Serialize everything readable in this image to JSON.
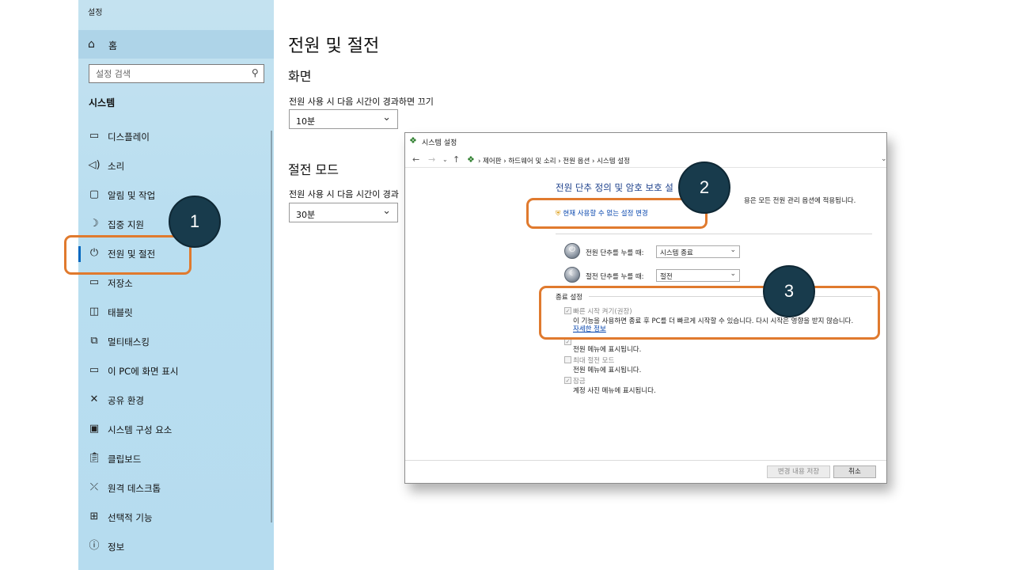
{
  "settings": {
    "window_title": "설정",
    "home": "홈",
    "search_placeholder": "설정 검색",
    "section": "시스템",
    "nav": [
      {
        "label": "디스플레이",
        "icon": "display-icon"
      },
      {
        "label": "소리",
        "icon": "sound-icon"
      },
      {
        "label": "알림 및 작업",
        "icon": "notifications-icon"
      },
      {
        "label": "집중 지원",
        "icon": "focus-assist-icon"
      },
      {
        "label": "전원 및 절전",
        "icon": "power-icon"
      },
      {
        "label": "저장소",
        "icon": "storage-icon"
      },
      {
        "label": "태블릿",
        "icon": "tablet-icon"
      },
      {
        "label": "멀티태스킹",
        "icon": "multitasking-icon"
      },
      {
        "label": "이 PC에 화면 표시",
        "icon": "projecting-icon"
      },
      {
        "label": "공유 환경",
        "icon": "shared-experiences-icon"
      },
      {
        "label": "시스템 구성 요소",
        "icon": "system-components-icon"
      },
      {
        "label": "클립보드",
        "icon": "clipboard-icon"
      },
      {
        "label": "원격 데스크톱",
        "icon": "remote-desktop-icon"
      },
      {
        "label": "선택적 기능",
        "icon": "optional-features-icon"
      },
      {
        "label": "정보",
        "icon": "info-icon"
      }
    ],
    "content": {
      "title": "전원 및 절전",
      "screen_section": "화면",
      "screen_label": "전원 사용 시 다음 시간이 경과하면 끄기",
      "screen_value": "10분",
      "sleep_section": "절전 모드",
      "sleep_label": "전원 사용 시 다음 시간이 경과",
      "sleep_value": "30분"
    }
  },
  "control_panel": {
    "title": "시스템 설정",
    "breadcrumbs": "›  제어판  ›  하드웨어 및 소리  ›  전원 옵션  ›  시스템 설정",
    "heading": "전원 단추 정의 및 암호 보호 설",
    "description": "용은 모든 전원 관리 옵션에 적용됩니다.",
    "change_link": "현재 사용할 수 없는 설정 변경",
    "power_button_label": "전원 단추를 누를 때:",
    "power_button_value": "시스템 종료",
    "sleep_button_label": "절전 단추를 누를 때:",
    "sleep_button_value": "절전",
    "shutdown_title": "종료 설정",
    "fast_startup_label": "빠른 시작 켜기(권장)",
    "fast_startup_desc": "이 기능을 사용하면 종료 후 PC를 더 빠르게 시작할 수 있습니다. 다시 시작은 영향을 받지 않습니다.",
    "more_info": "자세한 정보",
    "sleep_desc": "전원 메뉴에 표시됩니다.",
    "hibernate_label": "최대 절전 모드",
    "hibernate_desc": "전원 메뉴에 표시됩니다.",
    "lock_label": "잠금",
    "lock_desc": "계정 사진 메뉴에 표시됩니다.",
    "save_button": "변경 내용 저장",
    "cancel_button": "취소"
  },
  "annotations": {
    "badge_1": "1",
    "badge_2": "2",
    "badge_3": "3",
    "highlight_color": "#e07a2e",
    "badge_color": "#183b4c"
  }
}
